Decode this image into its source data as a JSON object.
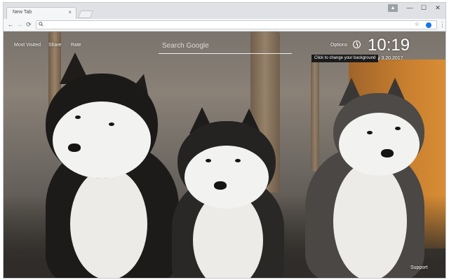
{
  "browser": {
    "tab_title": "New Tab",
    "tab_close": "×",
    "controls": {
      "user": "▲",
      "minimize": "—",
      "maximize": "☐",
      "close": "✕"
    },
    "nav": {
      "back": "←",
      "forward": "→",
      "reload": "⟳"
    },
    "omnibox": {
      "value": "",
      "placeholder": ""
    },
    "icons": {
      "search": "search-icon",
      "star": "star-icon",
      "menu": "menu-dots-icon"
    }
  },
  "newtab": {
    "links": {
      "most_visited": "Most Visited",
      "share": "Share",
      "rate": "Rate"
    },
    "search_placeholder": "Search Google",
    "options_label": "Options",
    "time": "10:19",
    "date": "y 3.20.2017",
    "tooltip": "Click to change your background",
    "support_label": "Support",
    "accent_color": "#ffffff"
  }
}
